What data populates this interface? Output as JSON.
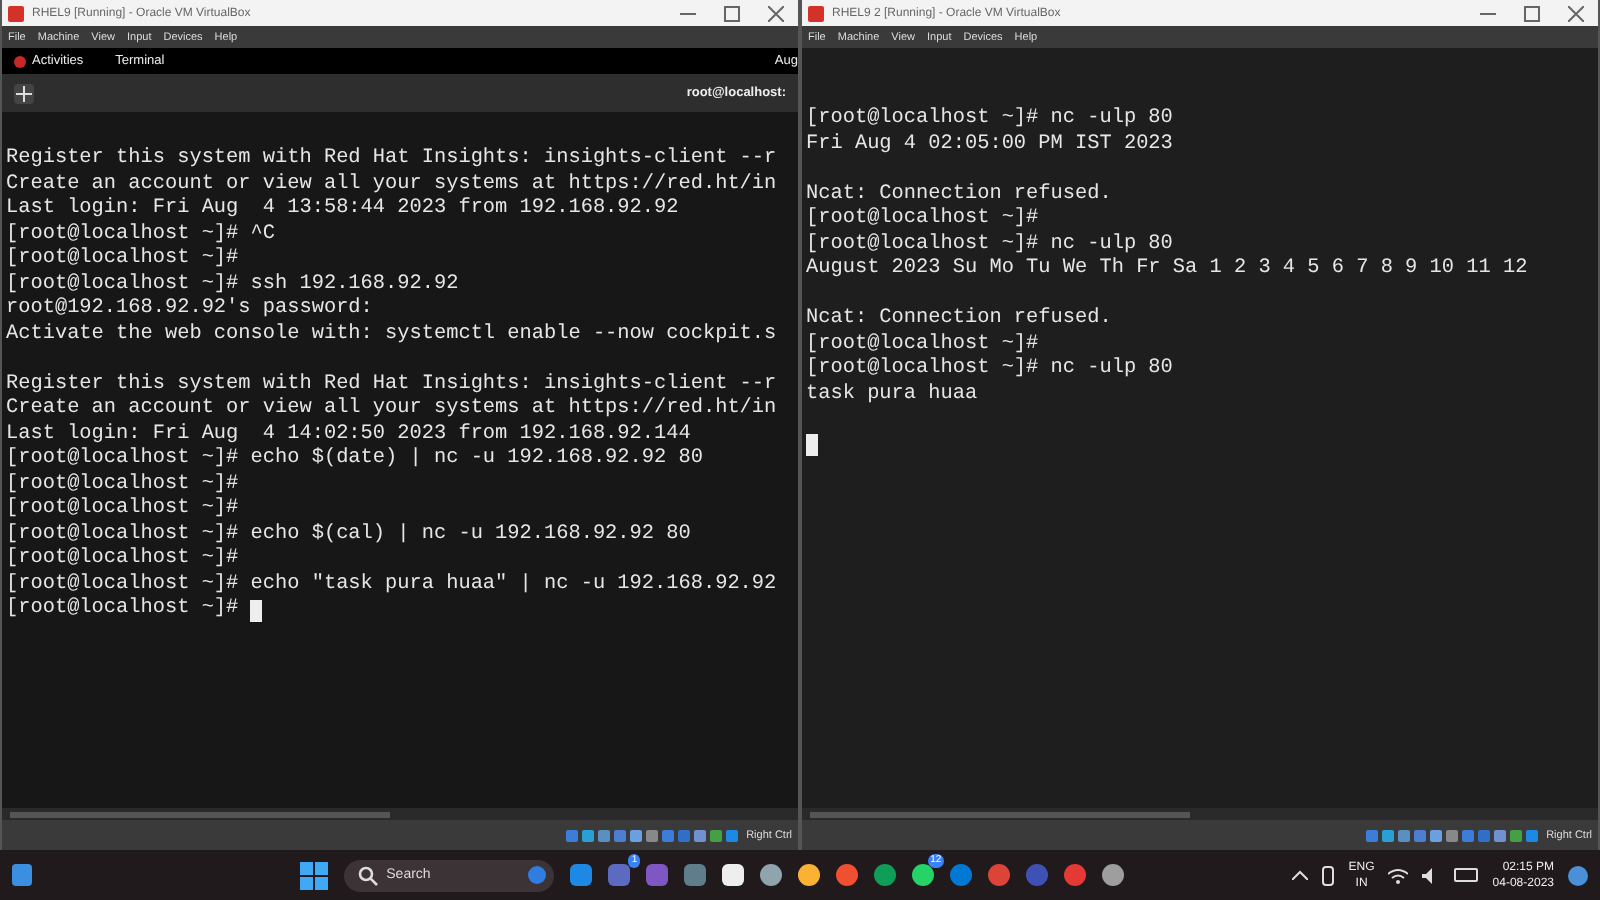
{
  "windows": [
    {
      "title": "RHEL9 [Running] - Oracle VM VirtualBox",
      "menu": [
        "File",
        "Machine",
        "View",
        "Input",
        "Devices",
        "Help"
      ],
      "gnome_bar": {
        "activities": "Activities",
        "app": "Terminal",
        "clock": "Aug"
      },
      "terminal_title": "root@localhost:",
      "blocks": [
        [
          "Register this system with Red Hat Insights: insights-client --r",
          "Create an account or view all your systems at https://red.ht/in",
          "Last login: Fri Aug  4 13:58:44 2023 from 192.168.92.92",
          "[root@localhost ~]# ^C",
          "[root@localhost ~]#",
          "[root@localhost ~]# ssh 192.168.92.92",
          "root@192.168.92.92's password:",
          "Activate the web console with: systemctl enable --now cockpit.s"
        ],
        [
          "Register this system with Red Hat Insights: insights-client --r",
          "Create an account or view all your systems at https://red.ht/in",
          "Last login: Fri Aug  4 14:02:50 2023 from 192.168.92.144",
          "[root@localhost ~]# echo $(date) | nc -u 192.168.92.92 80",
          "[root@localhost ~]#",
          "[root@localhost ~]#",
          "[root@localhost ~]# echo $(cal) | nc -u 192.168.92.92 80",
          "[root@localhost ~]#",
          "[root@localhost ~]# echo \"task pura huaa\" | nc -u 192.168.92.92",
          "[root@localhost ~]# "
        ]
      ],
      "cursor_inline": true,
      "host_key": "Right Ctrl"
    },
    {
      "title": "RHEL9 2 [Running] - Oracle VM VirtualBox",
      "menu": [
        "File",
        "Machine",
        "View",
        "Input",
        "Devices",
        "Help"
      ],
      "blocks": [
        [
          "[root@localhost ~]# nc -ulp 80",
          "Fri Aug 4 02:05:00 PM IST 2023"
        ],
        [
          "Ncat: Connection refused.",
          "[root@localhost ~]#",
          "[root@localhost ~]# nc -ulp 80",
          "August 2023 Su Mo Tu We Th Fr Sa 1 2 3 4 5 6 7 8 9 10 11 12"
        ],
        [
          "Ncat: Connection refused.",
          "[root@localhost ~]#",
          "[root@localhost ~]# nc -ulp 80",
          "task pura huaa"
        ]
      ],
      "cursor_inline": false,
      "host_key": "Right Ctrl"
    }
  ],
  "taskbar": {
    "search_placeholder": "Search",
    "chat_badge": "1",
    "whatsapp_badge": "12",
    "language": "ENG",
    "region": "IN",
    "time": "02:15 PM",
    "date": "04-08-2023"
  }
}
